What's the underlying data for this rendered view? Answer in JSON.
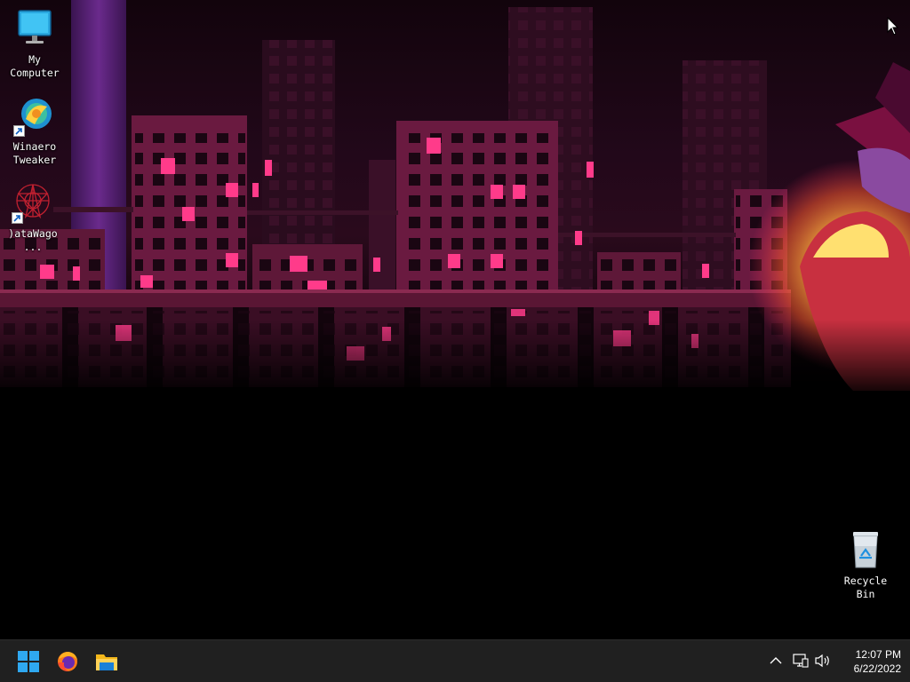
{
  "desktop": {
    "icons": [
      {
        "label": "My\nComputer",
        "icon": "monitor-icon"
      },
      {
        "label": "Winaero\nTweaker",
        "icon": "winaero-tweaker-icon",
        "shortcut": true
      },
      {
        "label": ")ataWago ...",
        "icon": "datawagon-icon",
        "shortcut": true
      },
      {
        "label": "Recycle\nBin",
        "icon": "recycle-bin-icon"
      }
    ]
  },
  "taskbar": {
    "pinned": [
      {
        "name": "start",
        "icon": "windows-logo-icon"
      },
      {
        "name": "firefox",
        "icon": "firefox-icon"
      },
      {
        "name": "file-explorer",
        "icon": "folder-icon"
      }
    ],
    "tray": {
      "chevron": "chevron-up-icon",
      "network": "network-icon",
      "volume": "speaker-icon"
    },
    "clock": {
      "time": "12:07 PM",
      "date": "6/22/2022"
    }
  },
  "colors": {
    "accent": "#ff3b8a",
    "taskbar": "#202020",
    "wallpaper_sky": "#1a0713"
  }
}
